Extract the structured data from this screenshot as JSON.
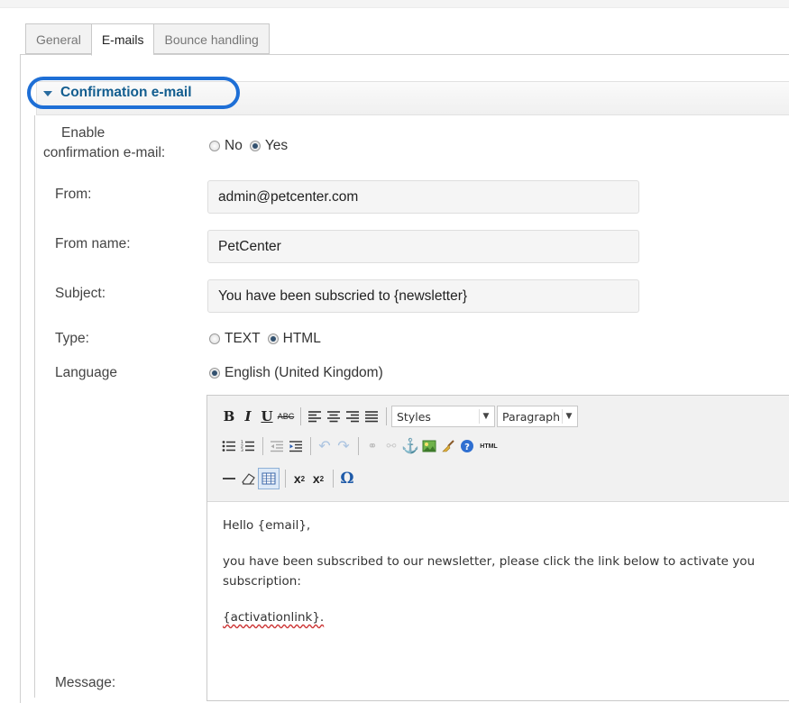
{
  "tabs": [
    {
      "label": "General",
      "active": false
    },
    {
      "label": "E-mails",
      "active": true
    },
    {
      "label": "Bounce handling",
      "active": false
    }
  ],
  "section": {
    "title": "Confirmation e-mail"
  },
  "form": {
    "enable_label_line1": "Enable",
    "enable_label_line2": "confirmation e-mail:",
    "enable_options": {
      "no": "No",
      "yes": "Yes",
      "selected": "Yes"
    },
    "from_label": "From:",
    "from_value": "admin@petcenter.com",
    "from_name_label": "From name:",
    "from_name_value": "PetCenter",
    "subject_label": "Subject:",
    "subject_value": "You have been subscried to  {newsletter}",
    "type_label": "Type:",
    "type_options": {
      "text": "TEXT",
      "html": "HTML",
      "selected": "HTML"
    },
    "language_label": "Language",
    "language_option": "English (United Kingdom)",
    "message_label": "Message:"
  },
  "editor": {
    "toolbar": {
      "styles_value": "Styles",
      "paragraph_value": "Paragraph",
      "html_label": "HTML"
    },
    "content": {
      "line1": "Hello {email},",
      "line2a": "you have been subscribed to our newsletter, please click the link below to activate you",
      "line2b": "subscription:",
      "line3": "{activationlink}."
    }
  },
  "colors": {
    "section_title": "#125d8f",
    "highlight_ring": "#1e6fd6"
  }
}
